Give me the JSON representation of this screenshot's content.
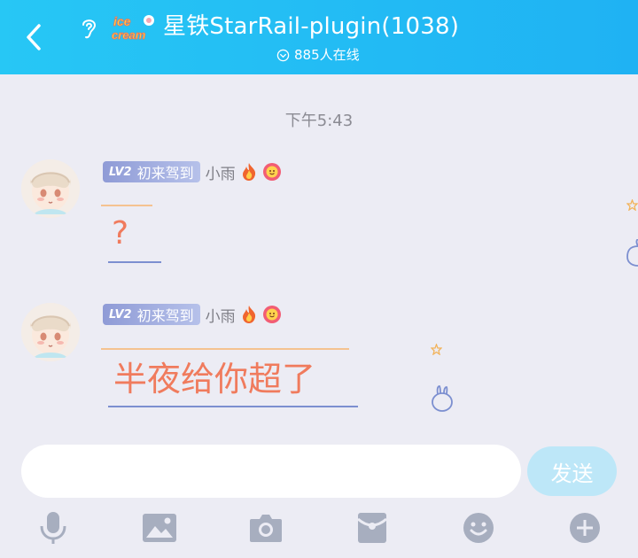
{
  "header": {
    "title": "星铁StarRail-plugin(1038)",
    "online": "885人在线",
    "badge_text": "ice cream"
  },
  "timestamp": "下午5:43",
  "messages": [
    {
      "level": "LV2",
      "title": "初来驾到",
      "sender": "小雨",
      "text": "?"
    },
    {
      "level": "LV2",
      "title": "初来驾到",
      "sender": "小雨",
      "text": "半夜给你超了"
    }
  ],
  "input": {
    "value": "",
    "send_label": "发送"
  },
  "toolbar": {
    "icons": [
      "microphone-icon",
      "image-icon",
      "camera-icon",
      "red-packet-icon",
      "emoji-icon",
      "plus-icon"
    ]
  },
  "colors": {
    "header": "#1fb2f3",
    "message_text": "#f07b5d",
    "send_button": "#bde7f8",
    "toolbar_icon": "#a7aebf"
  }
}
